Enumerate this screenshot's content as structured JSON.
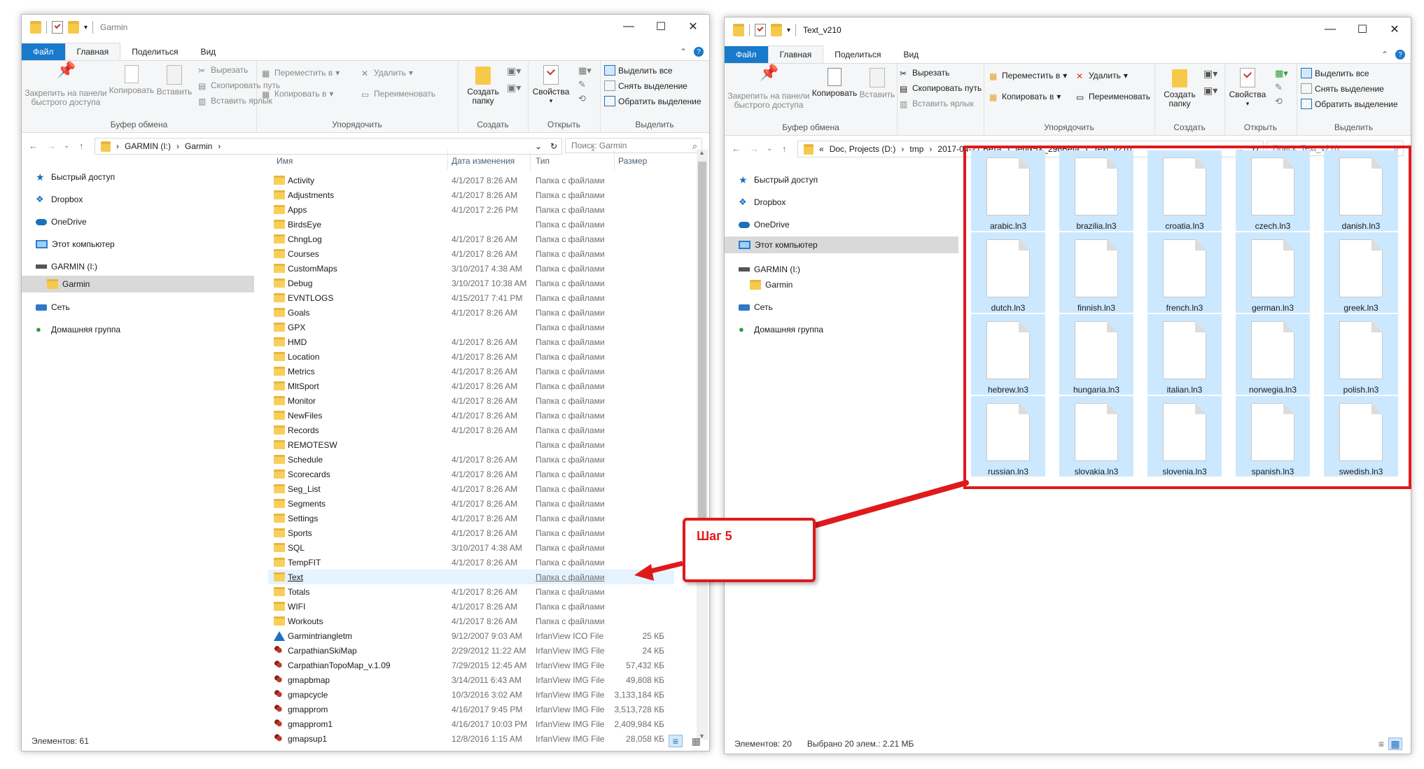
{
  "left_window": {
    "title": "Garmin",
    "tabs": {
      "file": "Файл",
      "home": "Главная",
      "share": "Поделиться",
      "view": "Вид"
    },
    "ribbon": {
      "pin": "Закрепить на панели быстрого доступа",
      "copy": "Копировать",
      "paste": "Вставить",
      "cut": "Вырезать",
      "copy_path": "Скопировать путь",
      "paste_shortcut": "Вставить ярлык",
      "move_to": "Переместить в",
      "copy_to": "Копировать в",
      "delete": "Удалить",
      "rename": "Переименовать",
      "new_folder": "Создать папку",
      "properties": "Свойства",
      "select_all": "Выделить все",
      "select_none": "Снять выделение",
      "invert_selection": "Обратить выделение",
      "group_clipboard": "Буфер обмена",
      "group_organize": "Упорядочить",
      "group_new": "Создать",
      "group_open": "Открыть",
      "group_select": "Выделить"
    },
    "address": {
      "part1": "GARMIN (I:)",
      "part2": "Garmin"
    },
    "search_placeholder": "Поиск: Garmin",
    "nav": {
      "quick": "Быстрый доступ",
      "dropbox": "Dropbox",
      "onedrive": "OneDrive",
      "pc": "Этот компьютер",
      "drive": "GARMIN (I:)",
      "folder": "Garmin",
      "network": "Сеть",
      "homegroup": "Домашняя группа"
    },
    "columns": {
      "name": "Имя",
      "date": "Дата изменения",
      "type": "Тип",
      "size": "Размер"
    },
    "files": [
      {
        "name": "Activity",
        "date": "4/1/2017 8:26 AM",
        "type": "Папка с файлами",
        "size": "",
        "icon": "folder"
      },
      {
        "name": "Adjustments",
        "date": "4/1/2017 8:26 AM",
        "type": "Папка с файлами",
        "size": "",
        "icon": "folder"
      },
      {
        "name": "Apps",
        "date": "4/1/2017 2:26 PM",
        "type": "Папка с файлами",
        "size": "",
        "icon": "folder"
      },
      {
        "name": "BirdsEye",
        "date": "",
        "type": "Папка с файлами",
        "size": "",
        "icon": "folder"
      },
      {
        "name": "ChngLog",
        "date": "4/1/2017 8:26 AM",
        "type": "Папка с файлами",
        "size": "",
        "icon": "folder"
      },
      {
        "name": "Courses",
        "date": "4/1/2017 8:26 AM",
        "type": "Папка с файлами",
        "size": "",
        "icon": "folder"
      },
      {
        "name": "CustomMaps",
        "date": "3/10/2017 4:38 AM",
        "type": "Папка с файлами",
        "size": "",
        "icon": "folder"
      },
      {
        "name": "Debug",
        "date": "3/10/2017 10:38 AM",
        "type": "Папка с файлами",
        "size": "",
        "icon": "folder"
      },
      {
        "name": "EVNTLOGS",
        "date": "4/15/2017 7:41 PM",
        "type": "Папка с файлами",
        "size": "",
        "icon": "folder"
      },
      {
        "name": "Goals",
        "date": "4/1/2017 8:26 AM",
        "type": "Папка с файлами",
        "size": "",
        "icon": "folder"
      },
      {
        "name": "GPX",
        "date": "",
        "type": "Папка с файлами",
        "size": "",
        "icon": "folder"
      },
      {
        "name": "HMD",
        "date": "4/1/2017 8:26 AM",
        "type": "Папка с файлами",
        "size": "",
        "icon": "folder"
      },
      {
        "name": "Location",
        "date": "4/1/2017 8:26 AM",
        "type": "Папка с файлами",
        "size": "",
        "icon": "folder"
      },
      {
        "name": "Metrics",
        "date": "4/1/2017 8:26 AM",
        "type": "Папка с файлами",
        "size": "",
        "icon": "folder"
      },
      {
        "name": "MltSport",
        "date": "4/1/2017 8:26 AM",
        "type": "Папка с файлами",
        "size": "",
        "icon": "folder"
      },
      {
        "name": "Monitor",
        "date": "4/1/2017 8:26 AM",
        "type": "Папка с файлами",
        "size": "",
        "icon": "folder"
      },
      {
        "name": "NewFiles",
        "date": "4/1/2017 8:26 AM",
        "type": "Папка с файлами",
        "size": "",
        "icon": "folder"
      },
      {
        "name": "Records",
        "date": "4/1/2017 8:26 AM",
        "type": "Папка с файлами",
        "size": "",
        "icon": "folder"
      },
      {
        "name": "REMOTESW",
        "date": "",
        "type": "Папка с файлами",
        "size": "",
        "icon": "folder"
      },
      {
        "name": "Schedule",
        "date": "4/1/2017 8:26 AM",
        "type": "Папка с файлами",
        "size": "",
        "icon": "folder"
      },
      {
        "name": "Scorecards",
        "date": "4/1/2017 8:26 AM",
        "type": "Папка с файлами",
        "size": "",
        "icon": "folder"
      },
      {
        "name": "Seg_List",
        "date": "4/1/2017 8:26 AM",
        "type": "Папка с файлами",
        "size": "",
        "icon": "folder"
      },
      {
        "name": "Segments",
        "date": "4/1/2017 8:26 AM",
        "type": "Папка с файлами",
        "size": "",
        "icon": "folder"
      },
      {
        "name": "Settings",
        "date": "4/1/2017 8:26 AM",
        "type": "Папка с файлами",
        "size": "",
        "icon": "folder"
      },
      {
        "name": "Sports",
        "date": "4/1/2017 8:26 AM",
        "type": "Папка с файлами",
        "size": "",
        "icon": "folder"
      },
      {
        "name": "SQL",
        "date": "3/10/2017 4:38 AM",
        "type": "Папка с файлами",
        "size": "",
        "icon": "folder"
      },
      {
        "name": "TempFIT",
        "date": "4/1/2017 8:26 AM",
        "type": "Папка с файлами",
        "size": "",
        "icon": "folder"
      },
      {
        "name": "Text",
        "date": "",
        "type": "Папка с файлами",
        "size": "",
        "icon": "folder",
        "hover": true
      },
      {
        "name": "Totals",
        "date": "4/1/2017 8:26 AM",
        "type": "Папка с файлами",
        "size": "",
        "icon": "folder"
      },
      {
        "name": "WIFI",
        "date": "4/1/2017 8:26 AM",
        "type": "Папка с файлами",
        "size": "",
        "icon": "folder"
      },
      {
        "name": "Workouts",
        "date": "4/1/2017 8:26 AM",
        "type": "Папка с файлами",
        "size": "",
        "icon": "folder"
      },
      {
        "name": "Garmintriangletm",
        "date": "9/12/2007 9:03 AM",
        "type": "IrfanView ICO File",
        "size": "25 КБ",
        "icon": "tri"
      },
      {
        "name": "CarpathianSkiMap",
        "date": "2/29/2012 11:22 AM",
        "type": "IrfanView IMG File",
        "size": "24 КБ",
        "icon": "img"
      },
      {
        "name": "CarpathianTopoMap_v.1.09",
        "date": "7/29/2015 12:45 AM",
        "type": "IrfanView IMG File",
        "size": "57,432 КБ",
        "icon": "img"
      },
      {
        "name": "gmapbmap",
        "date": "3/14/2011 6:43 AM",
        "type": "IrfanView IMG File",
        "size": "49,808 КБ",
        "icon": "img"
      },
      {
        "name": "gmapcycle",
        "date": "10/3/2016 3:02 AM",
        "type": "IrfanView IMG File",
        "size": "3,133,184 КБ",
        "icon": "img"
      },
      {
        "name": "gmapprom",
        "date": "4/16/2017 9:45 PM",
        "type": "IrfanView IMG File",
        "size": "3,513,728 КБ",
        "icon": "img"
      },
      {
        "name": "gmapprom1",
        "date": "4/16/2017 10:03 PM",
        "type": "IrfanView IMG File",
        "size": "2,409,984 КБ",
        "icon": "img"
      },
      {
        "name": "gmapsup1",
        "date": "12/8/2016 1:15 AM",
        "type": "IrfanView IMG File",
        "size": "28,058 КБ",
        "icon": "img"
      }
    ],
    "status": "Элементов: 61"
  },
  "right_window": {
    "title": "Text_v210",
    "tabs": {
      "file": "Файл",
      "home": "Главная",
      "share": "Поделиться",
      "view": "Вид"
    },
    "ribbon": {
      "pin": "Закрепить на панели быстрого доступа",
      "copy": "Копировать",
      "paste": "Вставить",
      "cut": "Вырезать",
      "copy_path": "Скопировать путь",
      "paste_shortcut": "Вставить ярлык",
      "move_to": "Переместить в",
      "copy_to": "Копировать в",
      "delete": "Удалить",
      "rename": "Переименовать",
      "new_folder": "Создать папку",
      "properties": "Свойства",
      "select_all": "Выделить все",
      "select_none": "Снять выделение",
      "invert_selection": "Обратить выделение",
      "group_clipboard": "Буфер обмена",
      "group_organize": "Упорядочить",
      "group_new": "Создать",
      "group_open": "Открыть",
      "group_select": "Выделить"
    },
    "address": {
      "part1": "Doc, Projects (D:)",
      "part2": "tmp",
      "part3": "2017-04-27 Бета",
      "part4": "fenix5X_296Beta",
      "part5": "Text_v210"
    },
    "search_placeholder": "Поиск: Text_v210",
    "nav": {
      "quick": "Быстрый доступ",
      "dropbox": "Dropbox",
      "onedrive": "OneDrive",
      "pc": "Этот компьютер",
      "drive": "GARMIN (I:)",
      "folder": "Garmin",
      "network": "Сеть",
      "homegroup": "Домашняя группа"
    },
    "files": [
      "arabic.ln3",
      "brazilia.ln3",
      "croatia.ln3",
      "czech.ln3",
      "danish.ln3",
      "dutch.ln3",
      "finnish.ln3",
      "french.ln3",
      "german.ln3",
      "greek.ln3",
      "hebrew.ln3",
      "hungaria.ln3",
      "italian.ln3",
      "norwegia.ln3",
      "polish.ln3",
      "russian.ln3",
      "slovakia.ln3",
      "slovenia.ln3",
      "spanish.ln3",
      "swedish.ln3"
    ],
    "status_count": "Элементов: 20",
    "status_selected": "Выбрано 20 элем.: 2.21 МБ"
  },
  "annotation": {
    "label": "Шаг 5",
    "color": "#e0191b"
  }
}
